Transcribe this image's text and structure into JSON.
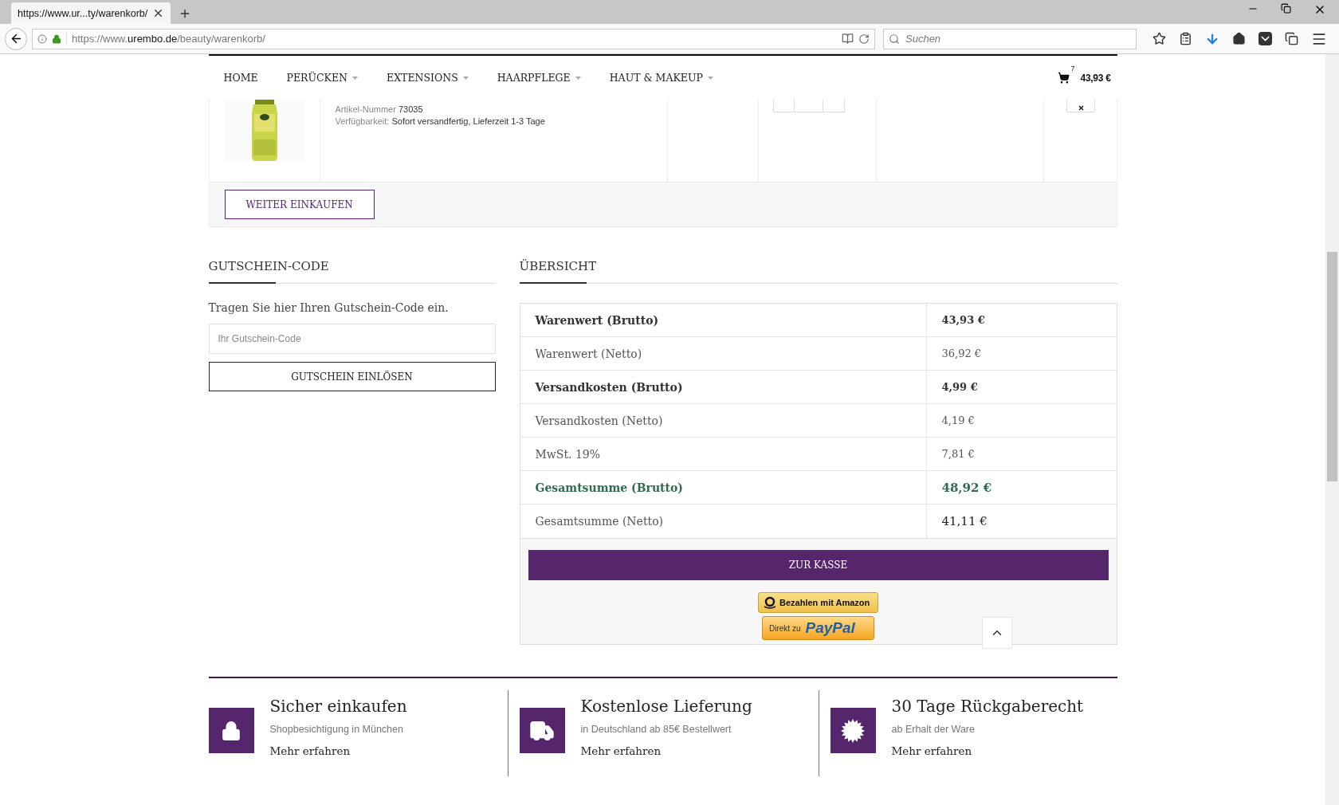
{
  "browser": {
    "tab_title": "https://www.ur...ty/warenkorb/",
    "url": "https://www.**urembo.de**/beauty/warenkorb/",
    "search_placeholder": "Suchen"
  },
  "nav": {
    "items": [
      {
        "label": "HOME",
        "dropdown": false
      },
      {
        "label": "PERÜCKEN",
        "dropdown": true
      },
      {
        "label": "EXTENSIONS",
        "dropdown": true
      },
      {
        "label": "HAARPFLEGE",
        "dropdown": true
      },
      {
        "label": "HAUT & MAKEUP",
        "dropdown": true
      }
    ],
    "cart_count": "7",
    "cart_total": "43,93 €"
  },
  "product": {
    "article_label": "Artikel-Nummer",
    "article_number": "73035",
    "availability_label": "Verfügbarkeit:",
    "availability": "Sofort versandfertig, Lieferzeit 1-3 Tage"
  },
  "continue_button": "WEITER EINKAUFEN",
  "coupon": {
    "title": "GUTSCHEIN-CODE",
    "hint": "Tragen Sie hier Ihren Gutschein-Code ein.",
    "placeholder": "Ihr Gutschein-Code",
    "button": "GUTSCHEIN EINLÖSEN"
  },
  "summary": {
    "title": "ÜBERSICHT",
    "rows": [
      {
        "label": "Warenwert (Brutto)",
        "value": "43,93 €",
        "kind": "bold"
      },
      {
        "label": "Warenwert (Netto)",
        "value": "36,92 €",
        "kind": "normal"
      },
      {
        "label": "Versandkosten (Brutto)",
        "value": "4,99 €",
        "kind": "bold"
      },
      {
        "label": "Versandkosten (Netto)",
        "value": "4,19 €",
        "kind": "normal"
      },
      {
        "label": "MwSt. 19%",
        "value": "7,81 €",
        "kind": "normal"
      },
      {
        "label": "Gesamtsumme (Brutto)",
        "value": "48,92 €",
        "kind": "total"
      },
      {
        "label": "Gesamtsumme (Netto)",
        "value": "41,11 €",
        "kind": "net_total"
      }
    ],
    "checkout_button": "ZUR KASSE",
    "amazon_button": "Bezahlen mit Amazon",
    "paypal_prefix": "Direkt zu",
    "paypal_brand": "PayPal"
  },
  "features": [
    {
      "kind": "lock",
      "title": "Sicher einkaufen",
      "subtitle": "Shopbesichtigung in München",
      "link": "Mehr erfahren"
    },
    {
      "kind": "truck",
      "title": "Kostenlose Lieferung",
      "subtitle": "in Deutschland ab 85€ Bestellwert",
      "link": "Mehr erfahren"
    },
    {
      "kind": "seal",
      "title": "30 Tage Rückgaberecht",
      "subtitle": "ab Erhalt der Ware",
      "link": "Mehr erfahren"
    }
  ]
}
